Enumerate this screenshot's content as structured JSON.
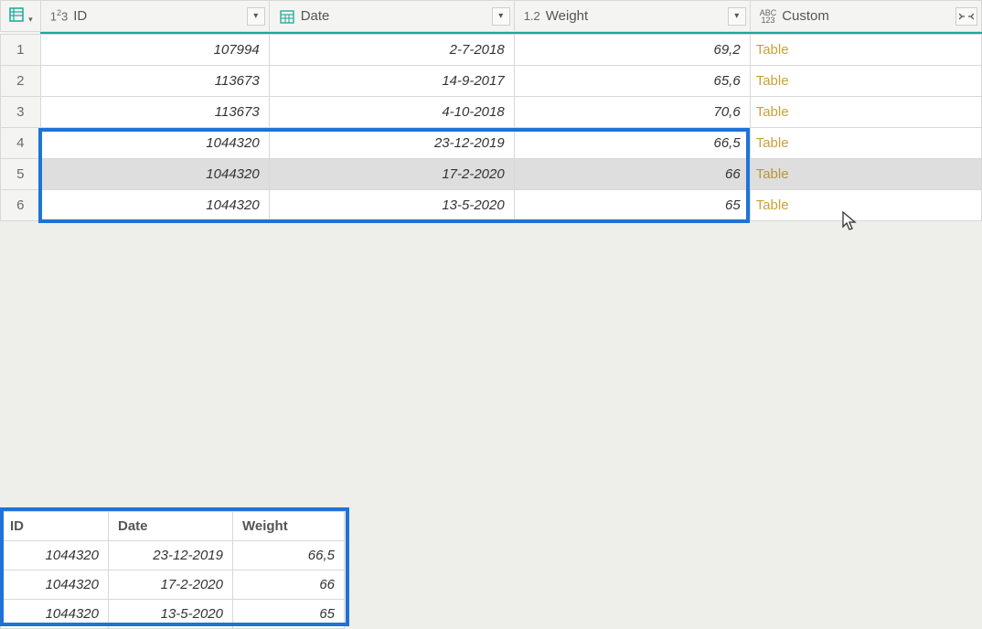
{
  "columns": {
    "id": {
      "label": "ID",
      "type_glyph": "1²3"
    },
    "date": {
      "label": "Date",
      "type_glyph": ""
    },
    "weight": {
      "label": "Weight",
      "type_glyph": "1.2"
    },
    "custom": {
      "label": "Custom",
      "type_glyph": "ABC123"
    }
  },
  "rows": [
    {
      "n": "1",
      "id": "107994",
      "date": "2-7-2018",
      "weight": "69,2",
      "custom": "Table"
    },
    {
      "n": "2",
      "id": "113673",
      "date": "14-9-2017",
      "weight": "65,6",
      "custom": "Table"
    },
    {
      "n": "3",
      "id": "113673",
      "date": "4-10-2018",
      "weight": "70,6",
      "custom": "Table"
    },
    {
      "n": "4",
      "id": "1044320",
      "date": "23-12-2019",
      "weight": "66,5",
      "custom": "Table"
    },
    {
      "n": "5",
      "id": "1044320",
      "date": "17-2-2020",
      "weight": "66",
      "custom": "Table"
    },
    {
      "n": "6",
      "id": "1044320",
      "date": "13-5-2020",
      "weight": "65",
      "custom": "Table"
    }
  ],
  "highlight_row_index": 4,
  "preview": {
    "headers": {
      "id": "ID",
      "date": "Date",
      "weight": "Weight"
    },
    "rows": [
      {
        "id": "1044320",
        "date": "23-12-2019",
        "weight": "66,5"
      },
      {
        "id": "1044320",
        "date": "17-2-2020",
        "weight": "66"
      },
      {
        "id": "1044320",
        "date": "13-5-2020",
        "weight": "65"
      }
    ]
  }
}
